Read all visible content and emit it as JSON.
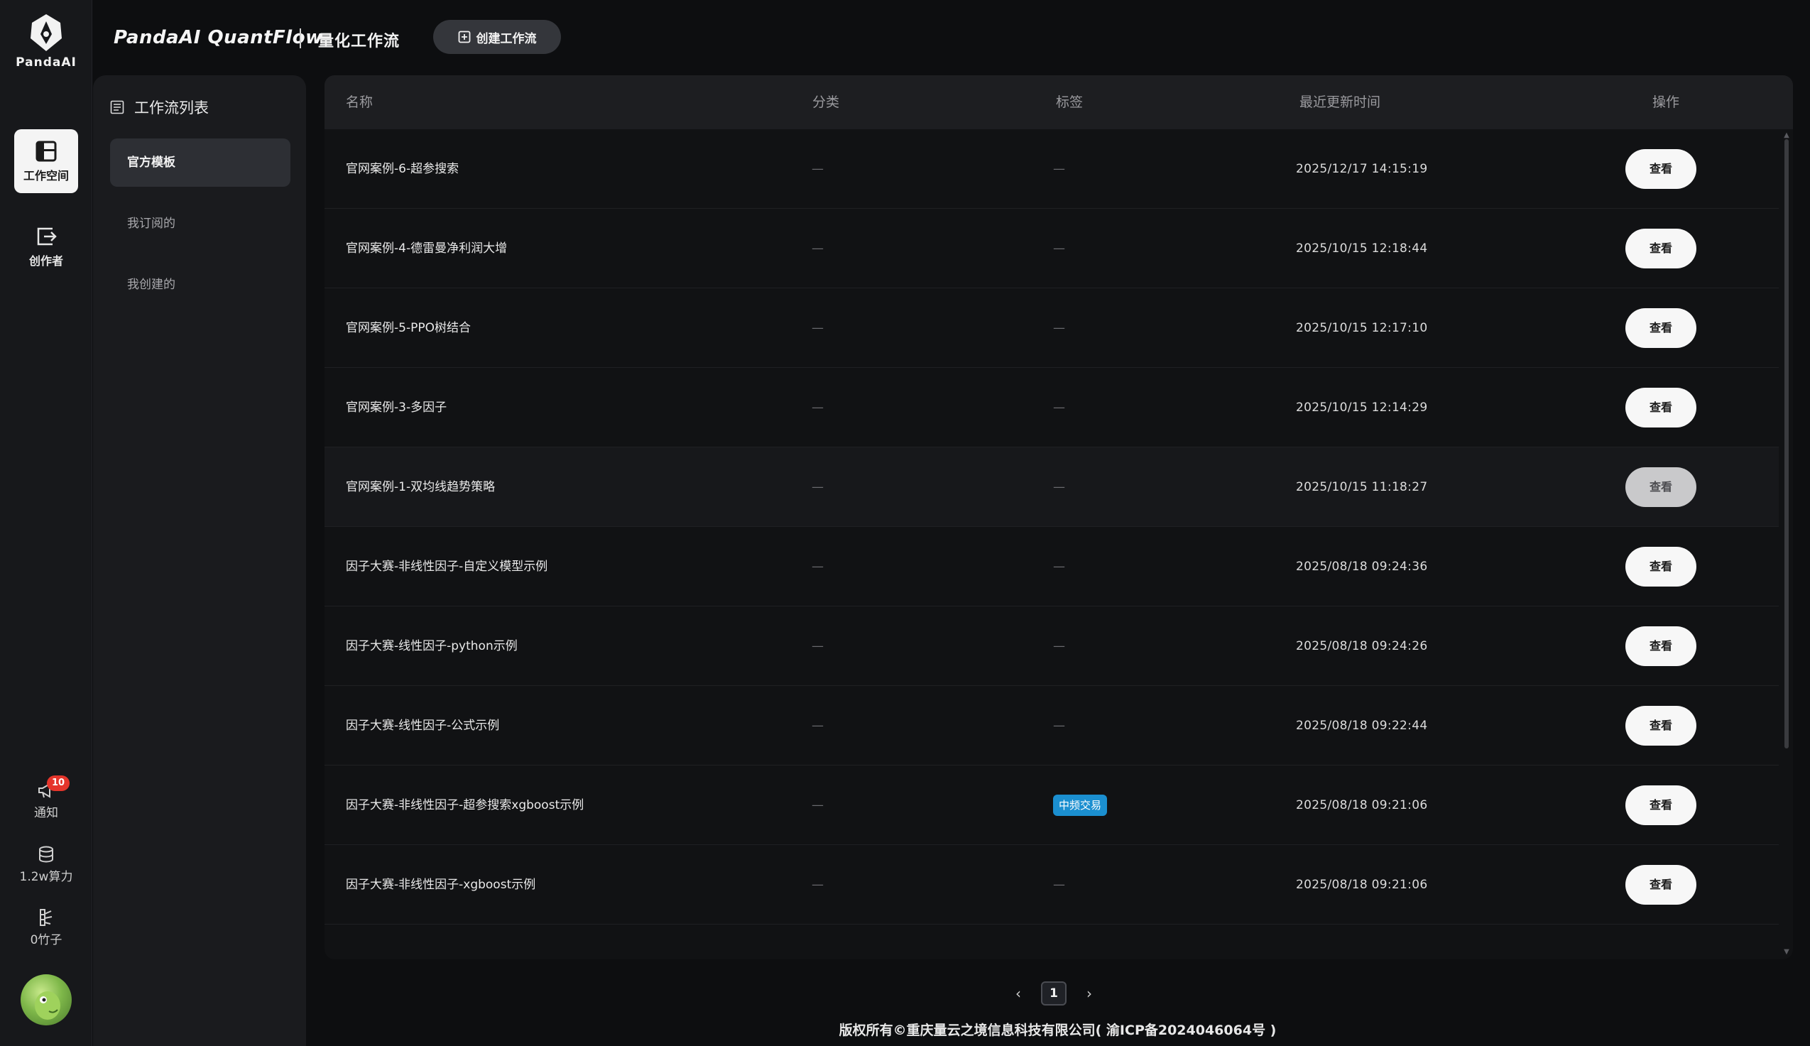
{
  "brand": {
    "logo_text": "PandaAI",
    "app_title": "PandaAI QuantFlow",
    "sub_title": "量化工作流",
    "create_label": "创建工作流"
  },
  "rail": {
    "workspace_label": "工作空间",
    "creator_label": "创作者",
    "notify_label": "通知",
    "notify_count": "10",
    "compute_label": "1.2w算力",
    "bamboo_label": "0竹子"
  },
  "sidebar": {
    "title": "工作流列表",
    "items": [
      {
        "label": "官方模板"
      },
      {
        "label": "我订阅的"
      },
      {
        "label": "我创建的"
      }
    ]
  },
  "table": {
    "headers": {
      "name": "名称",
      "category": "分类",
      "tag": "标签",
      "updated": "最近更新时间",
      "action": "操作"
    },
    "view_label": "查看",
    "dash": "—",
    "rows": [
      {
        "name": "官网案例-6-超参搜索",
        "category": "—",
        "tag": "",
        "updated": "2025/12/17 14:15:19"
      },
      {
        "name": "官网案例-4-德雷曼净利润大增",
        "category": "—",
        "tag": "",
        "updated": "2025/10/15 12:18:44"
      },
      {
        "name": "官网案例-5-PPO树结合",
        "category": "—",
        "tag": "",
        "updated": "2025/10/15 12:17:10"
      },
      {
        "name": "官网案例-3-多因子",
        "category": "—",
        "tag": "",
        "updated": "2025/10/15 12:14:29"
      },
      {
        "name": "官网案例-1-双均线趋势策略",
        "category": "—",
        "tag": "",
        "updated": "2025/10/15 11:18:27"
      },
      {
        "name": "因子大赛-非线性因子-自定义模型示例",
        "category": "—",
        "tag": "",
        "updated": "2025/08/18 09:24:36"
      },
      {
        "name": "因子大赛-线性因子-python示例",
        "category": "—",
        "tag": "",
        "updated": "2025/08/18 09:24:26"
      },
      {
        "name": "因子大赛-线性因子-公式示例",
        "category": "—",
        "tag": "",
        "updated": "2025/08/18 09:22:44"
      },
      {
        "name": "因子大赛-非线性因子-超参搜索xgboost示例",
        "category": "—",
        "tag": "中频交易",
        "updated": "2025/08/18 09:21:06"
      },
      {
        "name": "因子大赛-非线性因子-xgboost示例",
        "category": "—",
        "tag": "",
        "updated": "2025/08/18 09:21:06"
      }
    ]
  },
  "pagination": {
    "current": "1"
  },
  "footer": {
    "text": "版权所有©重庆量云之境信息科技有限公司( 渝ICP备2024046064号 )"
  },
  "colors": {
    "background": "#0d0e10",
    "rail": "#17181b",
    "tag": "#1b8fd0",
    "badge": "#e5352b"
  }
}
